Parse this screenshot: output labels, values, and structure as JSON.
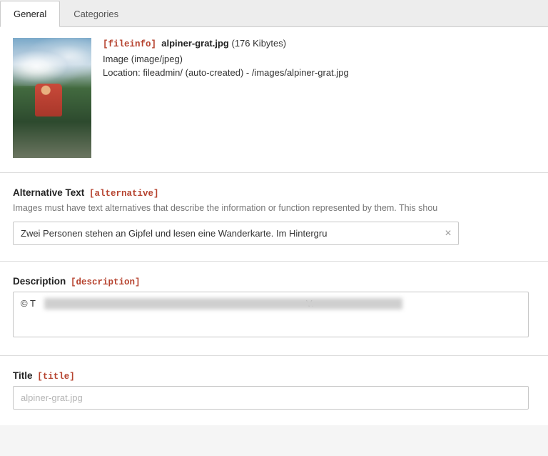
{
  "tabs": [
    {
      "label": "General",
      "active": true
    },
    {
      "label": "Categories",
      "active": false
    }
  ],
  "fileinfo": {
    "prop_tag": "[fileinfo]",
    "filename": "alpiner-grat.jpg",
    "filesize": "(176 Kibytes)",
    "mimetype": "Image (image/jpeg)",
    "location": "Location: fileadmin/ (auto-created) - /images/alpiner-grat.jpg"
  },
  "alternative": {
    "label": "Alternative Text",
    "prop_tag": "[alternative]",
    "help": "Images must have text alternatives that describe the information or function represented by them. This shou",
    "value": "Zwei Personen stehen an Gipfel und lesen eine Wanderkarte. Im Hintergru"
  },
  "description": {
    "label": "Description",
    "prop_tag": "[description]",
    "value_prefix": "© T",
    "value_suffix": " V."
  },
  "title": {
    "label": "Title",
    "prop_tag": "[title]",
    "placeholder": "alpiner-grat.jpg",
    "value": ""
  },
  "icons": {
    "clear": "×"
  }
}
